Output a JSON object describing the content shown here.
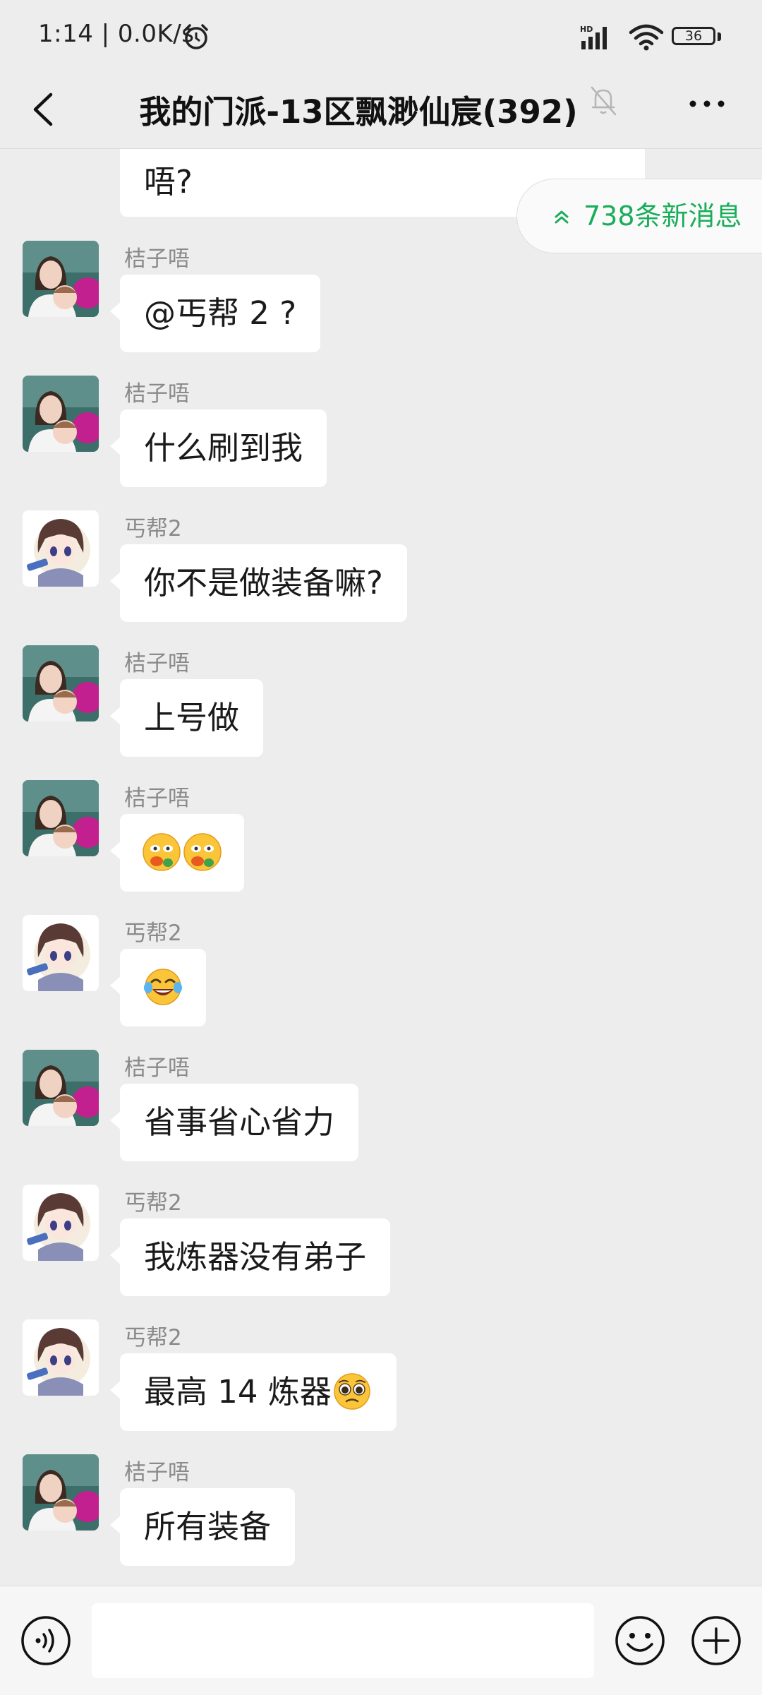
{
  "status_bar": {
    "time": "1:14 | 0.0K/s",
    "battery": "36",
    "network": "HD"
  },
  "header": {
    "title": "我的门派-13区飘渺仙宸(392)"
  },
  "new_messages": {
    "label": "738条新消息"
  },
  "messages": [
    {
      "sender": "",
      "text": "唔?",
      "partial": true
    },
    {
      "sender": "桔子唔",
      "text": "@丐帮 2 ?",
      "avatar": "woman-with-baby"
    },
    {
      "sender": "桔子唔",
      "text": "什么刷到我",
      "avatar": "woman-with-baby"
    },
    {
      "sender": "丐帮2",
      "text": "你不是做装备嘛?",
      "avatar": "anime-character"
    },
    {
      "sender": "桔子唔",
      "text": "上号做",
      "avatar": "woman-with-baby"
    },
    {
      "sender": "桔子唔",
      "text": "",
      "emojis": [
        "salute-face-emoji",
        "salute-face-emoji"
      ],
      "avatar": "woman-with-baby"
    },
    {
      "sender": "丐帮2",
      "text": "",
      "emojis": [
        "tears-of-joy-emoji"
      ],
      "avatar": "anime-character"
    },
    {
      "sender": "桔子唔",
      "text": "省事省心省力",
      "avatar": "woman-with-baby"
    },
    {
      "sender": "丐帮2",
      "text": "我炼器没有弟子",
      "avatar": "anime-character"
    },
    {
      "sender": "丐帮2",
      "text": "最高 14 炼器",
      "emojis": [
        "pleading-face-emoji"
      ],
      "avatar": "anime-character"
    },
    {
      "sender": "桔子唔",
      "text": "所有装备",
      "avatar": "woman-with-baby"
    }
  ],
  "input": {
    "value": "",
    "placeholder": ""
  },
  "icons": {
    "back": "back-arrow-icon",
    "mute": "mute-bell-icon",
    "more": "more-dots-icon",
    "voice": "voice-icon",
    "emoji": "emoji-face-icon",
    "plus": "plus-icon"
  },
  "colors": {
    "background": "#ededed",
    "bubble": "#ffffff",
    "accent_green": "#1aad5a",
    "sender_gray": "#8a8a8a"
  }
}
